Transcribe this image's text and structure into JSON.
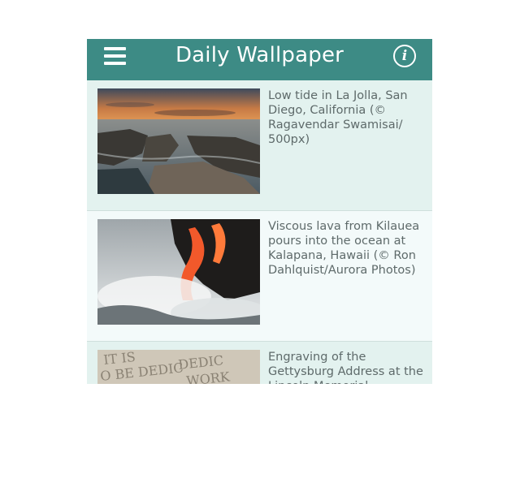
{
  "header": {
    "title": "Daily Wallpaper",
    "menu_icon": "hamburger-menu-icon",
    "info_icon": "info-icon",
    "info_glyph": "i",
    "background_color": "#3d8b85"
  },
  "wallpapers": [
    {
      "caption": "Low tide in La Jolla, San Diego, California (© Ragavendar Swamisai/ 500px)"
    },
    {
      "caption": "Viscous lava from Kilauea pours into the ocean at Kalapana, Hawaii (© Ron Dahlquist/Aurora Photos)"
    },
    {
      "caption": "Engraving of the Gettysburg Address at the Lincoln Memorial"
    }
  ]
}
